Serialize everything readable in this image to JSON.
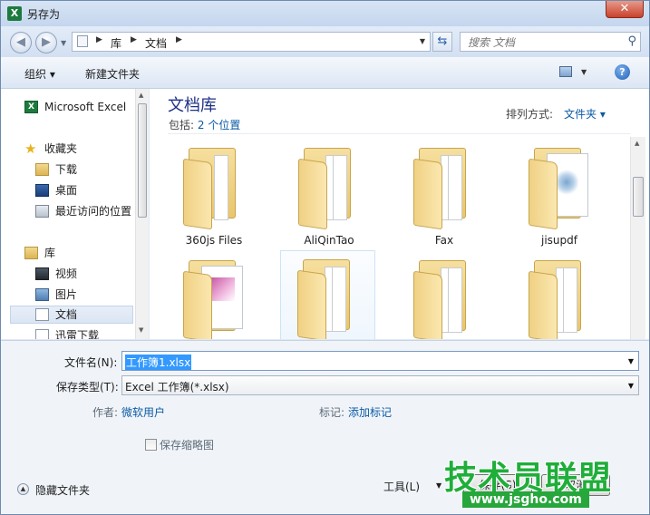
{
  "window": {
    "title": "另存为",
    "close_glyph": "✕",
    "app_icon": "excel-icon"
  },
  "address_bar": {
    "crumbs": [
      "库",
      "文档"
    ],
    "back_glyph": "◀",
    "forward_glyph": "▶"
  },
  "search": {
    "placeholder": "搜索 文档"
  },
  "toolbar": {
    "organize_label": "组织 ▾",
    "new_folder_label": "新建文件夹",
    "help_glyph": "?"
  },
  "nav_pane": {
    "items": [
      {
        "label": "Microsoft Excel",
        "icon": "excel-icon"
      },
      {
        "label": "收藏夹",
        "icon": "star-icon"
      },
      {
        "label": "下载",
        "icon": "download-folder-icon"
      },
      {
        "label": "桌面",
        "icon": "desktop-icon"
      },
      {
        "label": "最近访问的位置",
        "icon": "recent-places-icon"
      },
      {
        "label": "库",
        "icon": "library-icon"
      },
      {
        "label": "视频",
        "icon": "video-icon"
      },
      {
        "label": "图片",
        "icon": "pictures-icon"
      },
      {
        "label": "文档",
        "icon": "documents-icon",
        "selected": true
      },
      {
        "label": "迅雷下载",
        "icon": "thunder-download-icon"
      }
    ]
  },
  "content": {
    "library_title": "文档库",
    "includes_label": "包括:",
    "includes_link": "2 个位置",
    "arrange_label": "排列方式:",
    "arrange_value": "文件夹 ▾",
    "files": [
      {
        "name": "360js Files",
        "type": "folder"
      },
      {
        "name": "AliQinTao",
        "type": "folder"
      },
      {
        "name": "Fax",
        "type": "folder"
      },
      {
        "name": "jisupdf",
        "type": "folder-doc"
      },
      {
        "name": "",
        "type": "folder-doc"
      },
      {
        "name": "",
        "type": "folder"
      },
      {
        "name": "",
        "type": "folder"
      },
      {
        "name": "",
        "type": "folder"
      }
    ]
  },
  "form": {
    "filename_label": "文件名(N):",
    "filename_value": "工作簿1.xlsx",
    "filetype_label": "保存类型(T):",
    "filetype_value": "Excel 工作簿(*.xlsx)",
    "author_label": "作者:",
    "author_value": "微软用户",
    "tags_label": "标记:",
    "tags_value": "添加标记",
    "thumbnail_label": "保存缩略图",
    "hide_folders_label": "隐藏文件夹",
    "tools_label": "工具(L)",
    "save_label": "保存(S)",
    "cancel_label": "取消"
  },
  "watermark": {
    "title": "技术员联盟",
    "url": "www.jsgho.com"
  }
}
